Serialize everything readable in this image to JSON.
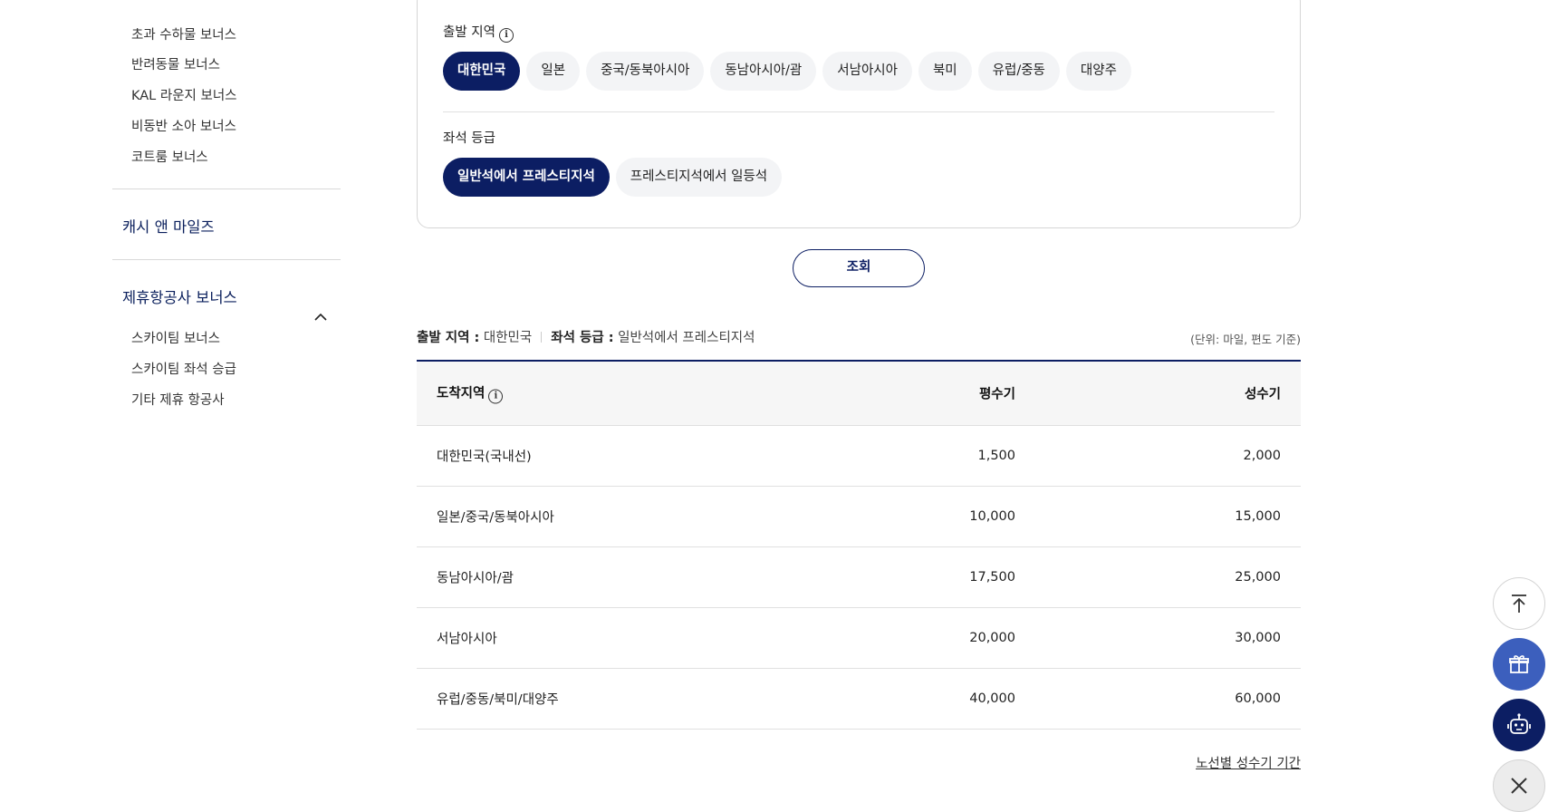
{
  "sidebar": {
    "bonus_items": [
      "초과 수하물 보너스",
      "반려동물 보너스",
      "KAL 라운지 보너스",
      "비동반 소아 보너스",
      "코트룸 보너스"
    ],
    "cash_and_miles": "캐시 앤 마일즈",
    "partner_section_title": "제휴항공사 보너스",
    "partner_items": [
      "스카이팀 보너스",
      "스카이팀 좌석 승급",
      "기타 제휴 항공사"
    ]
  },
  "filters": {
    "departure_label": "출발 지역",
    "departure_options": [
      "대한민국",
      "일본",
      "중국/동북아시아",
      "동남아시아/괌",
      "서남아시아",
      "북미",
      "유럽/중동",
      "대양주"
    ],
    "departure_selected": "대한민국",
    "seat_label": "좌석 등급",
    "seat_options": [
      "일반석에서 프레스티지석",
      "프레스티지석에서 일등석"
    ],
    "seat_selected": "일반석에서 프레스티지석",
    "search_button": "조회"
  },
  "summary": {
    "departure_key": "출발 지역 :",
    "departure_value": "대한민국",
    "seat_key": "좌석 등급 :",
    "seat_value": "일반석에서 프레스티지석",
    "unit_note": "(단위: 마일, 편도 기준)"
  },
  "table": {
    "headers": [
      "도착지역",
      "평수기",
      "성수기"
    ],
    "rows": [
      [
        "대한민국(국내선)",
        "1,500",
        "2,000"
      ],
      [
        "일본/중국/동북아시아",
        "10,000",
        "15,000"
      ],
      [
        "동남아시아/괌",
        "17,500",
        "25,000"
      ],
      [
        "서남아시아",
        "20,000",
        "30,000"
      ],
      [
        "유럽/중동/북미/대양주",
        "40,000",
        "60,000"
      ]
    ]
  },
  "route_link": "노선별 성수기 기간",
  "floating_buttons": [
    "arrow-up-icon",
    "gift-icon",
    "robot-icon",
    "close-icon"
  ],
  "colors": {
    "navy": "#0c1e63",
    "blue": "#3c5fbd",
    "chip_bg": "#f3f4f6"
  }
}
